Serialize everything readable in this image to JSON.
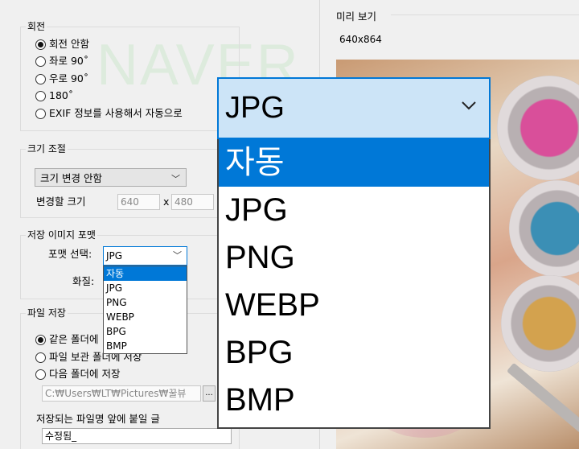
{
  "rotation": {
    "title": "회전",
    "options": [
      {
        "label": "회전 안함",
        "checked": true
      },
      {
        "label": "좌로 90˚",
        "checked": false
      },
      {
        "label": "우로 90˚",
        "checked": false
      },
      {
        "label": "180˚",
        "checked": false
      },
      {
        "label": "EXIF 정보를 사용해서 자동으로",
        "checked": false
      }
    ]
  },
  "resize": {
    "title": "크기 조절",
    "mode_value": "크기 변경 안함",
    "size_label": "변경할 크기",
    "width": "640",
    "x_label": "x",
    "height": "480"
  },
  "format": {
    "title": "저장 이미지 포맷",
    "format_label": "포맷 선택:",
    "selected": "JPG",
    "quality_label": "화질:",
    "options": [
      "자동",
      "JPG",
      "PNG",
      "WEBP",
      "BPG",
      "BMP"
    ],
    "highlighted": "자동"
  },
  "save": {
    "title": "파일 저장",
    "options": [
      {
        "label": "같은 폴더에",
        "checked": true
      },
      {
        "label": "파일 보관 폴더에 저장",
        "checked": false
      },
      {
        "label": "다음 폴더에 저장",
        "checked": false
      }
    ],
    "folder_path": "C:₩Users₩LT₩Pictures₩꿀뷰",
    "browse_label": "...",
    "prefix_label": "저장되는 파일명 앞에 붙일 글",
    "prefix_value": "수정됨_"
  },
  "preview": {
    "title": "미리 보기",
    "size": "640x864"
  },
  "zoom": {
    "selected": "JPG",
    "options": [
      "자동",
      "JPG",
      "PNG",
      "WEBP",
      "BPG",
      "BMP"
    ],
    "highlighted": "자동"
  },
  "watermark_text": "NAVER",
  "colors": {
    "accent": "#0078d7",
    "zoom_header_bg": "#cce4f7"
  }
}
